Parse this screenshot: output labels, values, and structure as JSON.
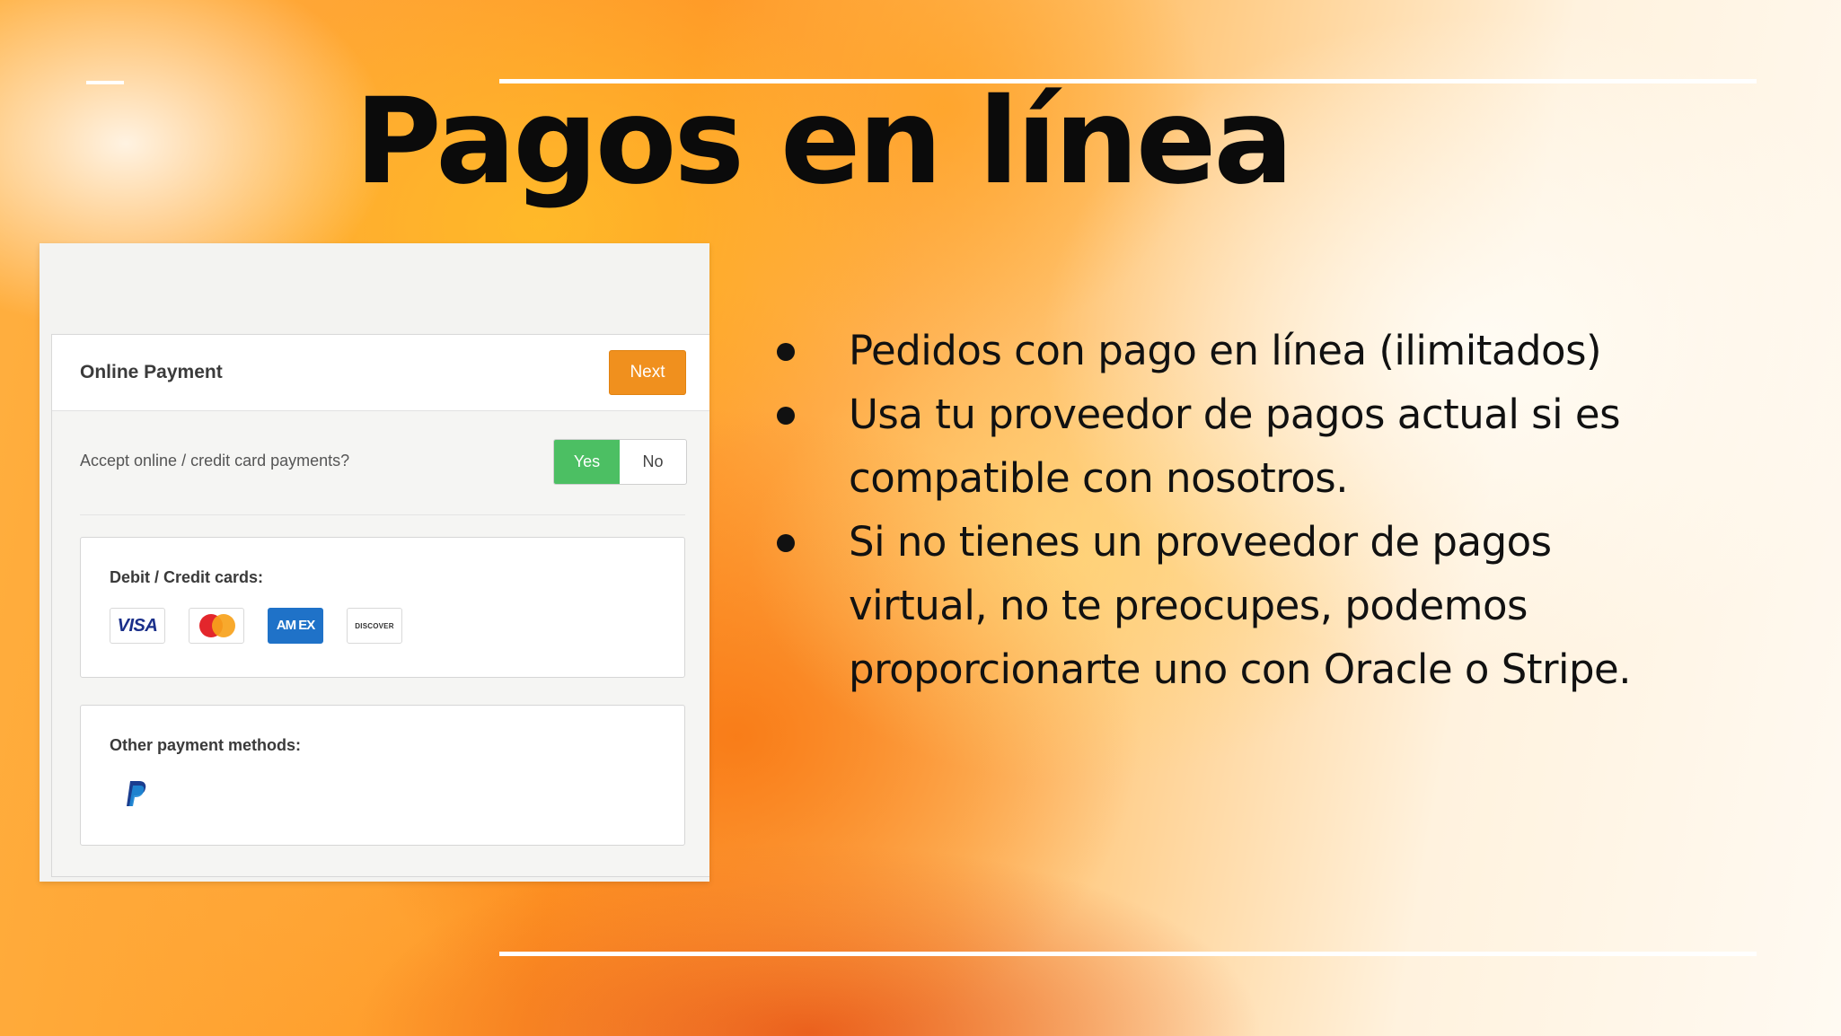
{
  "slide": {
    "title": "Pagos en línea",
    "bullets": [
      "Pedidos con pago en línea (ilimitados)",
      "Usa tu proveedor de pagos actual si es compatible con nosotros.",
      "Si no tienes un proveedor de pagos virtual, no te preocupes, podemos proporcionarte uno con Oracle o Stripe."
    ]
  },
  "payment": {
    "card_title": "Online Payment",
    "next_label": "Next",
    "accept_label": "Accept online / credit card payments?",
    "yes_label": "Yes",
    "no_label": "No",
    "cards_label": "Debit / Credit cards:",
    "visa_text": "VISA",
    "amex_text": "AM EX",
    "discover_text": "DISCOVER",
    "other_label": "Other payment methods:",
    "colors": {
      "next": "#f0901e",
      "yes": "#4cbf63"
    },
    "icons": [
      "visa-logo",
      "mastercard-logo",
      "amex-logo",
      "discover-logo",
      "paypal-logo"
    ]
  }
}
